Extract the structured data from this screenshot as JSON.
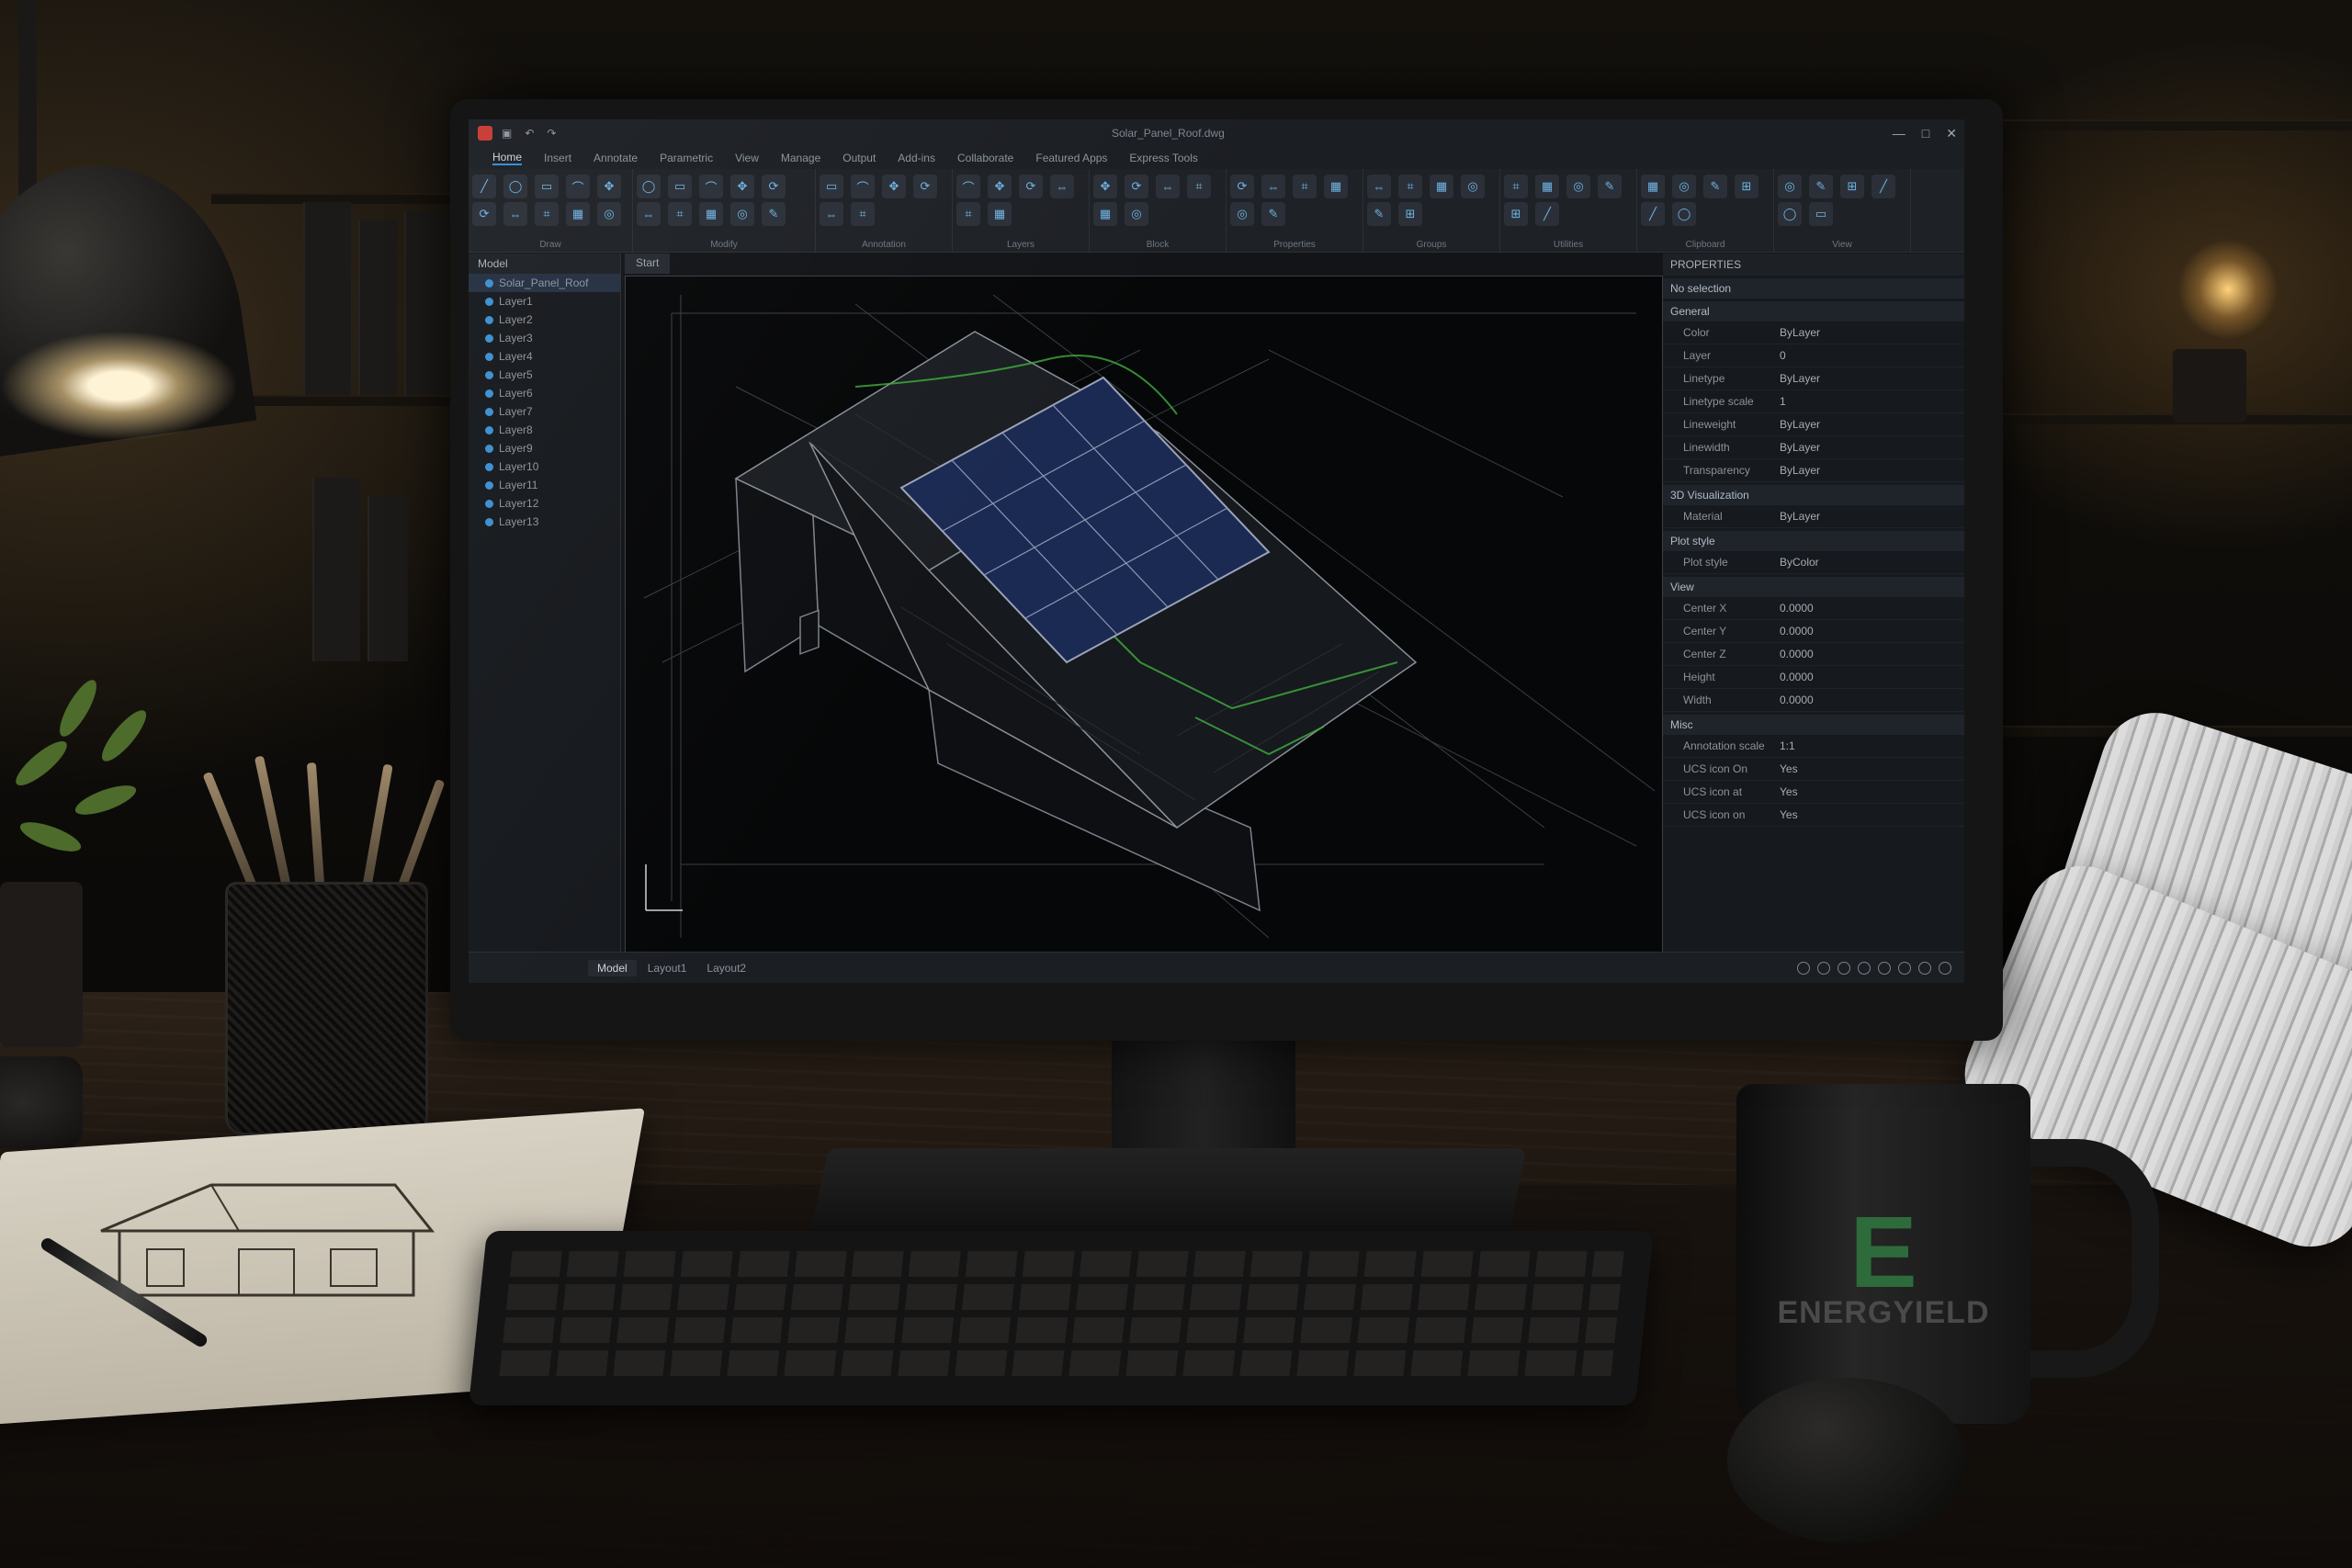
{
  "app": {
    "document_title": "Solar_Panel_Roof.dwg"
  },
  "ribbon_tabs": [
    {
      "label": "Home",
      "active": true
    },
    {
      "label": "Insert",
      "active": false
    },
    {
      "label": "Annotate",
      "active": false
    },
    {
      "label": "Parametric",
      "active": false
    },
    {
      "label": "View",
      "active": false
    },
    {
      "label": "Manage",
      "active": false
    },
    {
      "label": "Output",
      "active": false
    },
    {
      "label": "Add-ins",
      "active": false
    },
    {
      "label": "Collaborate",
      "active": false
    },
    {
      "label": "Featured Apps",
      "active": false
    },
    {
      "label": "Express Tools",
      "active": false
    }
  ],
  "ribbon_groups": [
    "Draw",
    "Modify",
    "Annotation",
    "Layers",
    "Block",
    "Properties",
    "Groups",
    "Utilities",
    "Clipboard",
    "View"
  ],
  "file_tabs": [
    "Start"
  ],
  "browser": {
    "title": "Model",
    "items": [
      "Solar_Panel_Roof",
      "Layer1",
      "Layer2",
      "Layer3",
      "Layer4",
      "Layer5",
      "Layer6",
      "Layer7",
      "Layer8",
      "Layer9",
      "Layer10",
      "Layer11",
      "Layer12",
      "Layer13"
    ]
  },
  "properties": {
    "title": "PROPERTIES",
    "selection": "No selection",
    "general_label": "General",
    "general_rows": [
      {
        "label": "Color",
        "value": "ByLayer"
      },
      {
        "label": "Layer",
        "value": "0"
      },
      {
        "label": "Linetype",
        "value": "ByLayer"
      },
      {
        "label": "Linetype scale",
        "value": "1"
      },
      {
        "label": "Lineweight",
        "value": "ByLayer"
      },
      {
        "label": "Linewidth",
        "value": "ByLayer"
      },
      {
        "label": "Transparency",
        "value": "ByLayer"
      }
    ],
    "viz_label": "3D Visualization",
    "viz_rows": [
      {
        "label": "Material",
        "value": "ByLayer"
      }
    ],
    "plot_label": "Plot style",
    "plot_rows": [
      {
        "label": "Plot style",
        "value": "ByColor"
      }
    ],
    "view_label": "View",
    "view_rows": [
      {
        "label": "Center X",
        "value": "0.0000"
      },
      {
        "label": "Center Y",
        "value": "0.0000"
      },
      {
        "label": "Center Z",
        "value": "0.0000"
      },
      {
        "label": "Height",
        "value": "0.0000"
      },
      {
        "label": "Width",
        "value": "0.0000"
      }
    ],
    "misc_label": "Misc",
    "misc_rows": [
      {
        "label": "Annotation scale",
        "value": "1:1"
      },
      {
        "label": "UCS icon On",
        "value": "Yes"
      },
      {
        "label": "UCS icon at",
        "value": "Yes"
      },
      {
        "label": "UCS icon on",
        "value": "Yes"
      }
    ]
  },
  "layout_tabs": [
    {
      "label": "Model",
      "active": true
    },
    {
      "label": "Layout1",
      "active": false
    },
    {
      "label": "Layout2",
      "active": false
    }
  ],
  "mug": {
    "letter": "E",
    "brand": "ENERGYIELD"
  },
  "colors": {
    "accent": "#2f8fd8",
    "solar_panel": "#1b2a52",
    "green_trace": "#3fae3f",
    "app_bg": "#121418"
  }
}
